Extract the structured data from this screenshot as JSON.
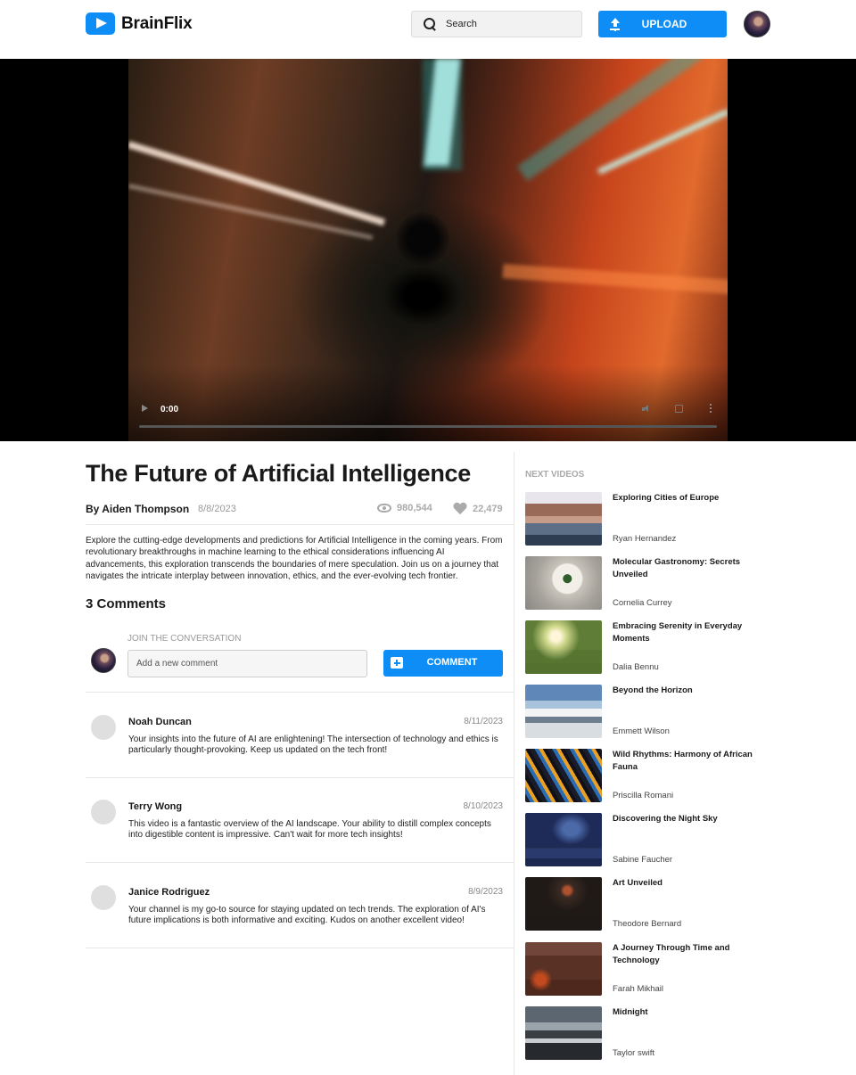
{
  "app": {
    "name": "BrainFlix",
    "accent_color": "#0d8df5"
  },
  "header": {
    "search_placeholder": "Search",
    "upload_label": "UPLOAD"
  },
  "video": {
    "time": "0:00",
    "progress": 0
  },
  "main": {
    "title": "The Future of Artificial Intelligence",
    "author": "By Aiden Thompson",
    "date": "8/8/2023",
    "views": "980,544",
    "likes": "22,479",
    "description": "Explore the cutting-edge developments and predictions for Artificial Intelligence in the coming years. From revolutionary breakthroughs in machine learning to the ethical considerations influencing AI advancements, this exploration transcends the boundaries of mere speculation. Join us on a journey that navigates the intricate interplay between innovation, ethics, and the ever-evolving tech frontier.",
    "comments_title": "3 Comments",
    "join_label": "JOIN THE CONVERSATION",
    "comment_placeholder": "Add a new comment",
    "comment_button": "COMMENT",
    "comments": [
      {
        "name": "Noah Duncan",
        "date": "8/11/2023",
        "text": "Your insights into the future of AI are enlightening! The intersection of technology and ethics is particularly thought-provoking. Keep us updated on the tech front!"
      },
      {
        "name": "Terry Wong",
        "date": "8/10/2023",
        "text": "This video is a fantastic overview of the AI landscape. Your ability to distill complex concepts into digestible content is impressive. Can't wait for more tech insights!"
      },
      {
        "name": "Janice Rodriguez",
        "date": "8/9/2023",
        "text": "Your channel is my go-to source for staying updated on tech trends. The exploration of AI's future implications is both informative and exciting. Kudos on another excellent video!"
      }
    ]
  },
  "sidebar": {
    "title": "NEXT VIDEOS",
    "videos": [
      {
        "title": "Exploring Cities of Europe",
        "author": "Ryan Hernandez"
      },
      {
        "title": "Molecular Gastronomy: Secrets Unveiled",
        "author": "Cornelia Currey"
      },
      {
        "title": "Embracing Serenity in Everyday Moments",
        "author": "Dalia Bennu"
      },
      {
        "title": "Beyond the Horizon",
        "author": "Emmett Wilson"
      },
      {
        "title": "Wild Rhythms: Harmony of African Fauna",
        "author": "Priscilla Romani"
      },
      {
        "title": "Discovering the Night Sky",
        "author": "Sabine Faucher"
      },
      {
        "title": "Art Unveiled",
        "author": "Theodore Bernard"
      },
      {
        "title": "A Journey Through Time and Technology",
        "author": "Farah Mikhail"
      },
      {
        "title": "Midnight",
        "author": "Taylor swift"
      }
    ]
  }
}
